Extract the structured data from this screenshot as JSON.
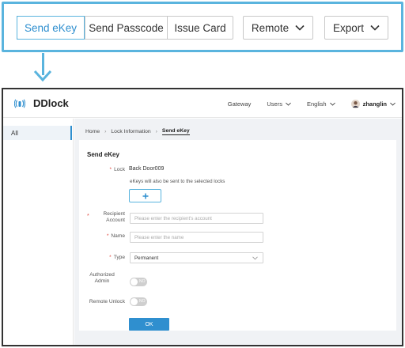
{
  "toolbar": {
    "buttons": [
      {
        "label": "Send eKey",
        "active": true
      },
      {
        "label": "Send Passcode",
        "active": false
      },
      {
        "label": "Issue Card",
        "active": false
      }
    ],
    "remote_label": "Remote",
    "export_label": "Export"
  },
  "header": {
    "app_name": "DDlock",
    "nav": {
      "gateway": "Gateway",
      "users": "Users",
      "language": "English",
      "username": "zhanglin"
    }
  },
  "sidebar": {
    "items": [
      {
        "label": "All",
        "active": true
      }
    ]
  },
  "breadcrumb": [
    "Home",
    "Lock Information",
    "Send eKey"
  ],
  "form": {
    "title": "Send eKey",
    "lock_label": "Lock",
    "lock_value": "Back Door009",
    "lock_hint": "eKeys will also be sent to the selected locks",
    "recipient_label_1": "Recipient",
    "recipient_label_2": "Account",
    "recipient_placeholder": "Please enter the recipient's account",
    "name_label": "Name",
    "name_placeholder": "Please enter the name",
    "type_label": "Type",
    "type_value": "Permanent",
    "authorized_label_1": "Authorized",
    "authorized_label_2": "Admin",
    "remote_unlock_label": "Remote Unlock",
    "toggle_text": "NO",
    "required_mark": "*",
    "ok_label": "OK"
  },
  "colors": {
    "accent": "#2f8fcf",
    "highlight_border": "#5ab4de",
    "required": "#e0453a"
  }
}
